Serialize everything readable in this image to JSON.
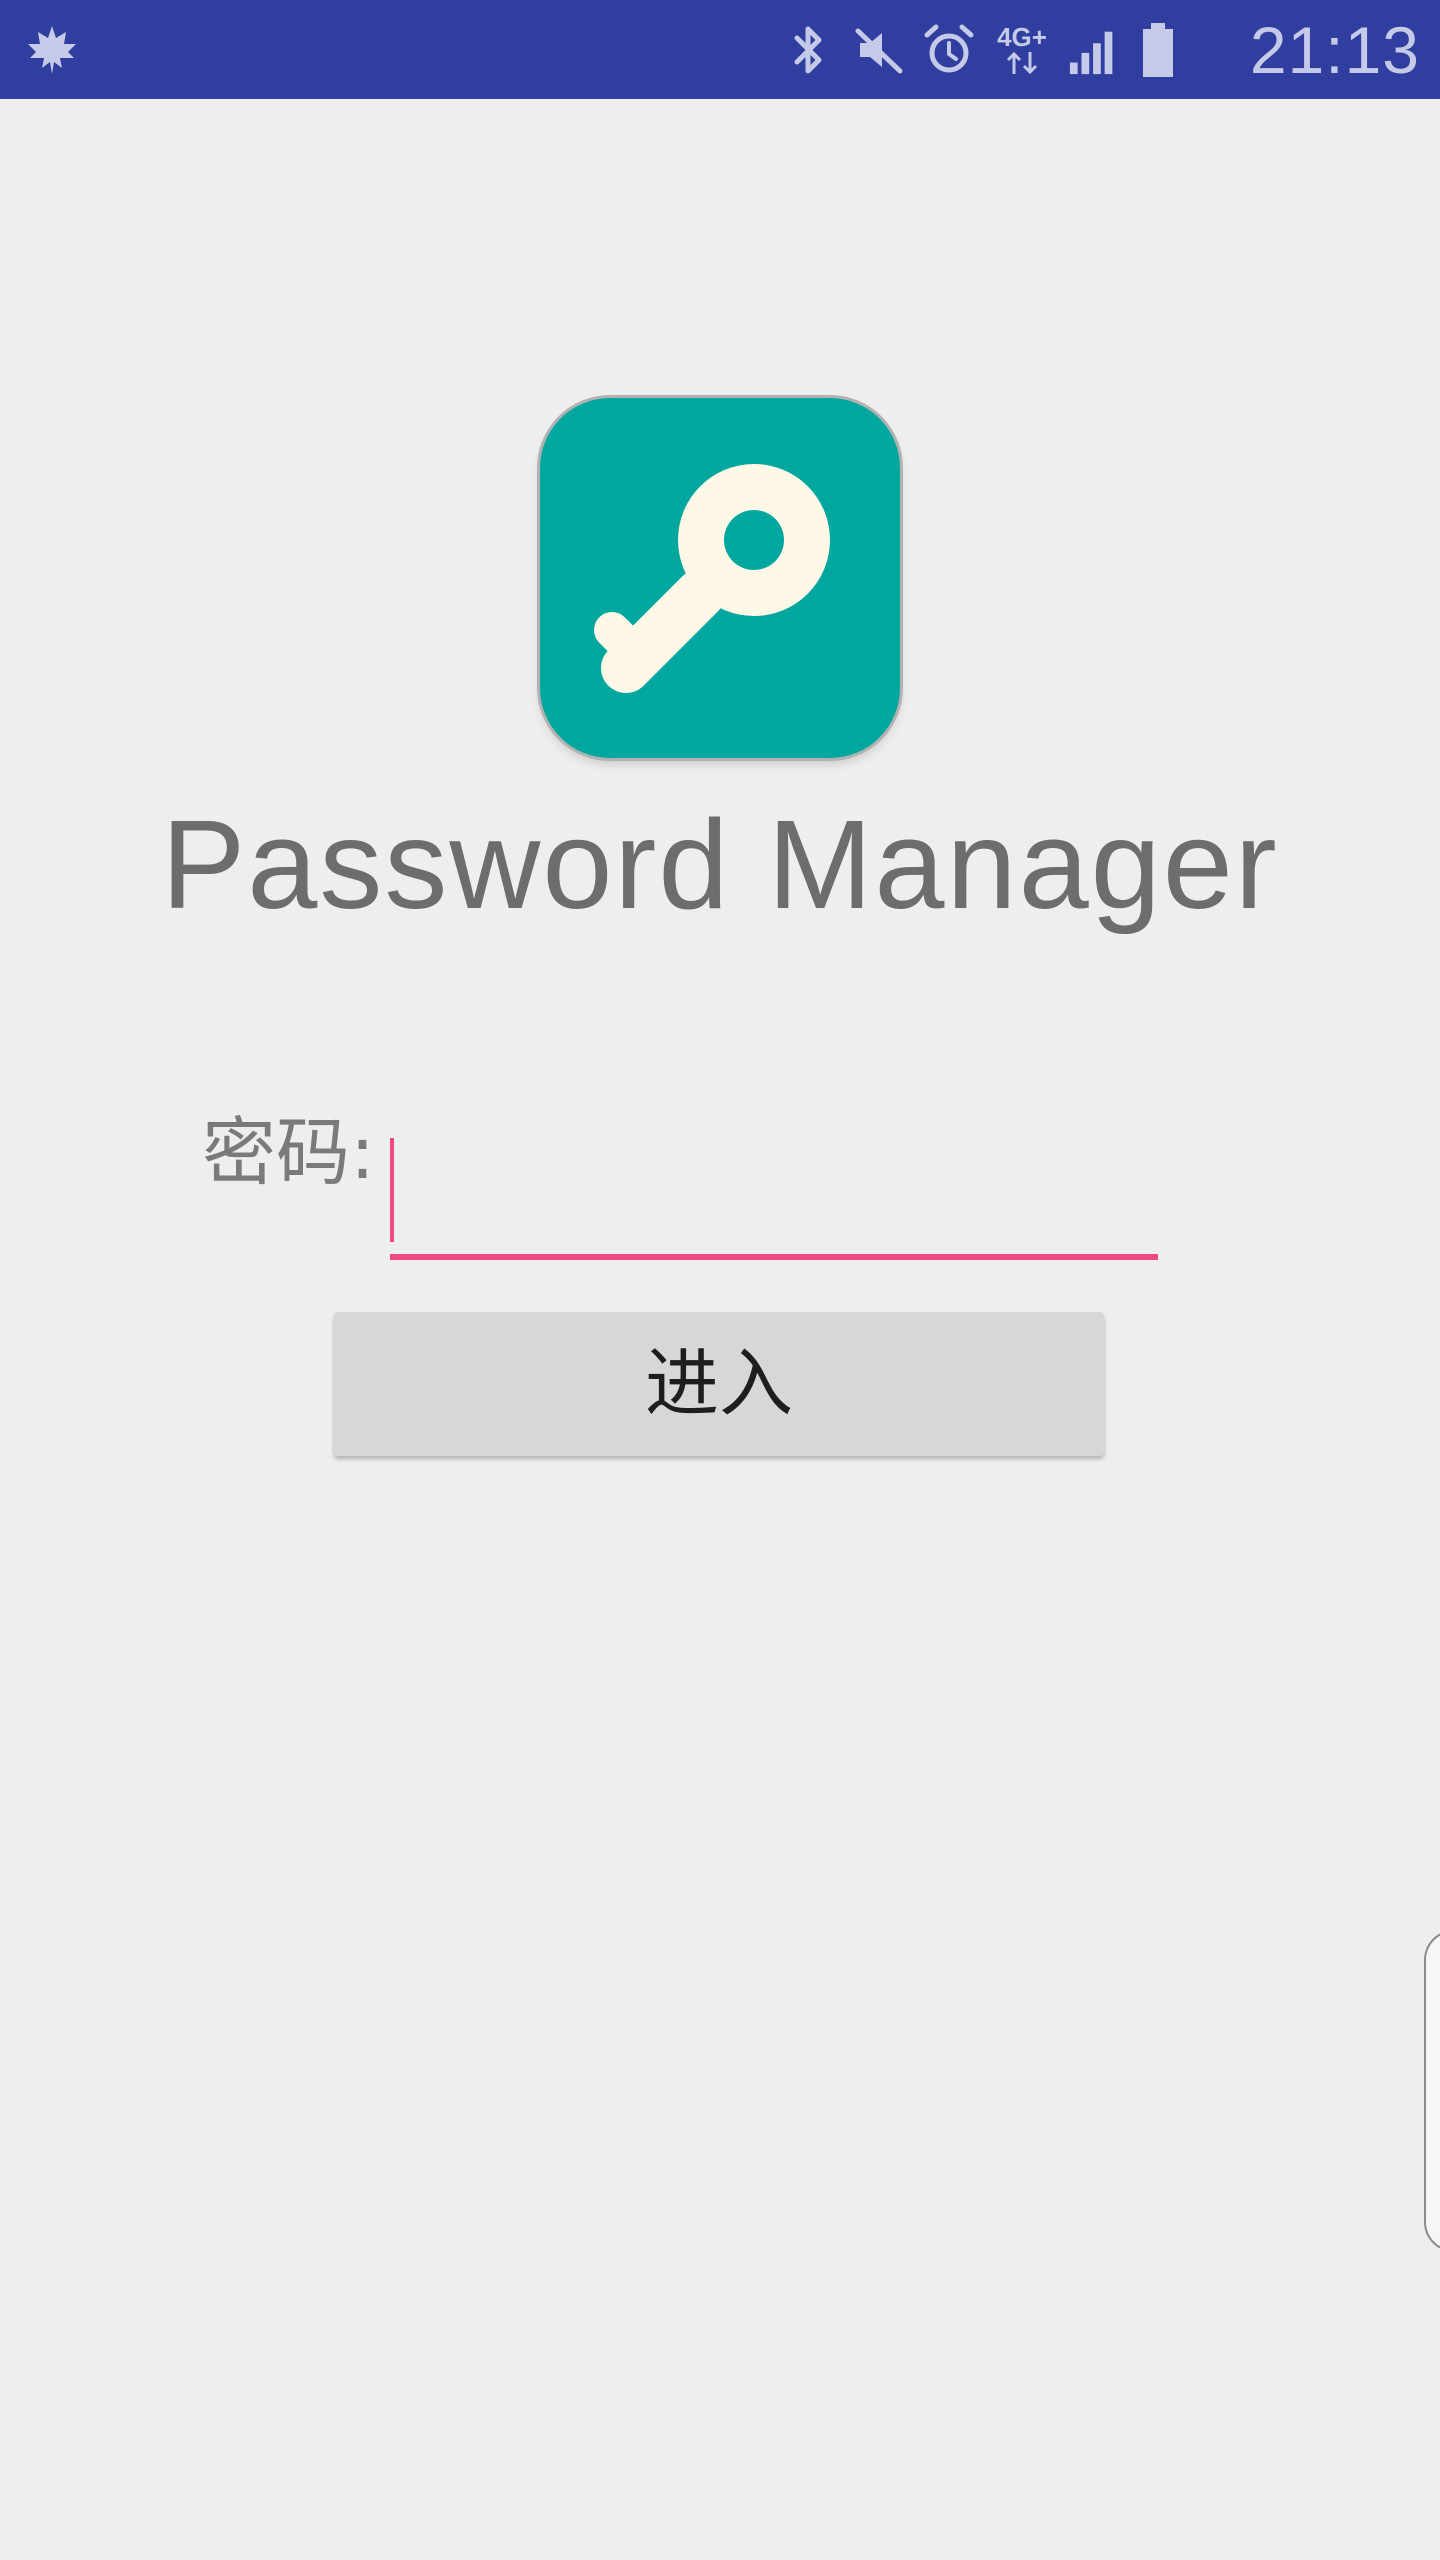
{
  "status_bar": {
    "time": "21:13",
    "network_type": "4G+",
    "icons": [
      "leaf-icon",
      "bluetooth-icon",
      "mute-icon",
      "alarm-icon",
      "network-4g-icon",
      "signal-icon",
      "battery-icon"
    ],
    "background_color": "#303f9f",
    "icon_color": "#c5cae9"
  },
  "app": {
    "icon": "key-icon",
    "icon_background_color": "#00a79f",
    "icon_foreground_color": "#fff8e7",
    "title": "Password Manager"
  },
  "form": {
    "password_label": "密码:",
    "password_value": "",
    "password_placeholder": "",
    "accent_color": "#f14982",
    "enter_button_label": "进入"
  }
}
